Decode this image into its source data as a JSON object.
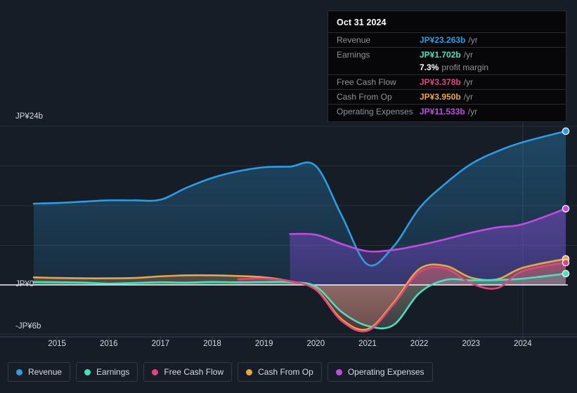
{
  "colors": {
    "background": "#161d27",
    "revenue": "#2e9ce0",
    "earnings": "#4ae0bf",
    "free_cash_flow": "#e0467a",
    "cash_from_op": "#e8a54b",
    "operating_expenses": "#c04ce0",
    "zero_axis": "#ffffff",
    "grid": "#2e3744",
    "tooltip_bg": "#07070a",
    "tooltip_border": "#2a2a30"
  },
  "tooltip": {
    "date": "Oct 31 2024",
    "rows": [
      {
        "label": "Revenue",
        "value": "JP¥23.263b",
        "unit": "/yr",
        "color": "#2e9ce0"
      },
      {
        "label": "Earnings",
        "value": "JP¥1.702b",
        "unit": "/yr",
        "color": "#4ae0bf"
      },
      {
        "label": "Free Cash Flow",
        "value": "JP¥3.378b",
        "unit": "/yr",
        "color": "#e0467a"
      },
      {
        "label": "Cash From Op",
        "value": "JP¥3.950b",
        "unit": "/yr",
        "color": "#e8a54b"
      },
      {
        "label": "Operating Expenses",
        "value": "JP¥11.533b",
        "unit": "/yr",
        "color": "#c04ce0"
      }
    ],
    "profit_margin_value": "7.3%",
    "profit_margin_text": "profit margin"
  },
  "legend": {
    "items": [
      {
        "label": "Revenue",
        "color": "#2e9ce0"
      },
      {
        "label": "Earnings",
        "color": "#4ae0bf"
      },
      {
        "label": "Free Cash Flow",
        "color": "#e0467a"
      },
      {
        "label": "Cash From Op",
        "color": "#e8a54b"
      },
      {
        "label": "Operating Expenses",
        "color": "#c04ce0"
      }
    ]
  },
  "axis": {
    "y_top_label": "JP¥24b",
    "y_zero_label": "JP¥0",
    "y_bottom_label": "-JP¥6b",
    "x_ticks": [
      "2015",
      "2016",
      "2017",
      "2018",
      "2019",
      "2020",
      "2021",
      "2022",
      "2023",
      "2024"
    ]
  },
  "chart_data": {
    "type": "area",
    "title": "",
    "xlabel": "",
    "ylabel": "JP¥ (billions)",
    "ylim": [
      -6,
      24
    ],
    "y_gridlines": [
      24,
      18,
      12,
      6,
      0,
      -6
    ],
    "grid": true,
    "legend_position": "bottom-left",
    "x": [
      2014.55,
      2015.0,
      2015.5,
      2016.0,
      2016.5,
      2017.0,
      2017.5,
      2018.0,
      2018.5,
      2019.0,
      2019.5,
      2020.0,
      2020.5,
      2021.0,
      2021.5,
      2022.0,
      2022.5,
      2023.0,
      2023.5,
      2024.0,
      2024.83
    ],
    "series": [
      {
        "name": "Revenue",
        "color": "#2e9ce0",
        "values": [
          12.3,
          12.4,
          12.6,
          12.8,
          12.8,
          12.9,
          14.7,
          16.2,
          17.2,
          17.8,
          17.9,
          18.0,
          10.5,
          3.1,
          5.8,
          11.6,
          15.3,
          18.3,
          20.2,
          21.6,
          23.263
        ]
      },
      {
        "name": "Earnings",
        "color": "#4ae0bf",
        "values": [
          0.45,
          0.4,
          0.35,
          0.2,
          0.3,
          0.4,
          0.35,
          0.45,
          0.4,
          0.45,
          0.4,
          -0.2,
          -3.3,
          -5.0,
          -4.9,
          -1.0,
          0.75,
          0.7,
          0.75,
          0.95,
          1.702
        ]
      },
      {
        "name": "Free Cash Flow",
        "color": "#e0467a",
        "values": [
          null,
          null,
          null,
          null,
          null,
          null,
          null,
          null,
          0.85,
          0.95,
          0.55,
          -0.6,
          -4.4,
          -5.6,
          -2.4,
          1.9,
          2.5,
          0.25,
          -0.4,
          2.1,
          3.378
        ]
      },
      {
        "name": "Cash From Op",
        "color": "#e8a54b",
        "values": [
          1.15,
          1.05,
          1.0,
          1.0,
          1.05,
          1.3,
          1.45,
          1.45,
          1.35,
          1.15,
          0.55,
          -0.5,
          -4.2,
          -5.4,
          -2.2,
          2.4,
          2.9,
          1.1,
          0.85,
          2.6,
          3.95
        ]
      },
      {
        "name": "Operating Expenses",
        "color": "#c04ce0",
        "values": [
          null,
          null,
          null,
          null,
          null,
          null,
          null,
          null,
          null,
          null,
          7.7,
          7.6,
          6.2,
          5.1,
          5.3,
          6.0,
          6.9,
          7.9,
          8.7,
          9.2,
          11.533
        ]
      }
    ]
  }
}
